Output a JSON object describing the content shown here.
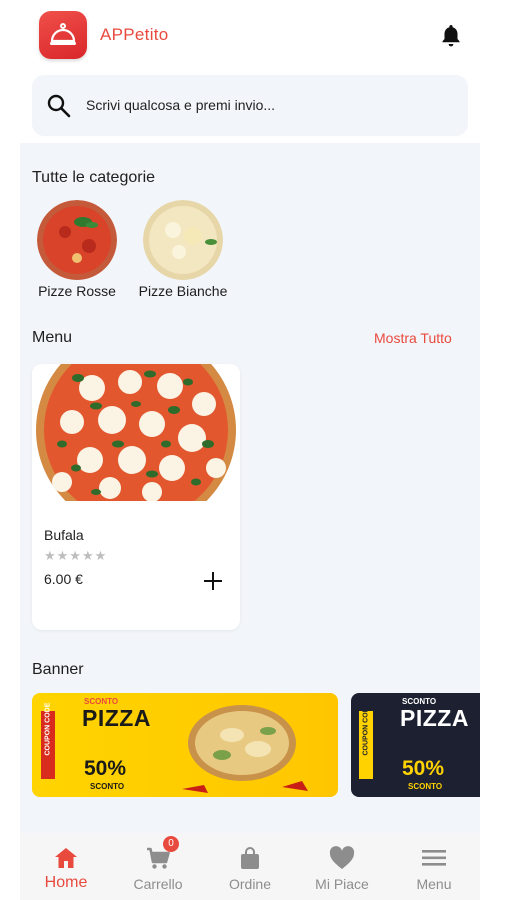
{
  "header": {
    "app_title": "APPetito",
    "logo_icon": "cloche-icon",
    "notification_icon": "bell-icon"
  },
  "search": {
    "placeholder": "Scrivi qualcosa e premi invio..."
  },
  "categories": {
    "title": "Tutte le categorie",
    "items": [
      {
        "label": "Pizze Rosse"
      },
      {
        "label": "Pizze Bianche"
      }
    ]
  },
  "menu": {
    "title": "Menu",
    "show_all": "Mostra Tutto",
    "items": [
      {
        "name": "Bufala",
        "rating": 0,
        "rating_max": 5,
        "price": "6.00 €"
      }
    ]
  },
  "banner": {
    "title": "Banner",
    "items": [
      {
        "tag": "COUPON CODE",
        "discount_label": "SCONTO",
        "headline": "PIZZA",
        "percent": "50%",
        "sub": "SCONTO"
      },
      {
        "tag": "COUPON CODE",
        "discount_label": "SCONTO",
        "headline": "PIZZA",
        "percent": "50%",
        "sub": "SCONTO"
      }
    ]
  },
  "bottom_nav": {
    "items": [
      {
        "label": "Home",
        "icon": "home-icon",
        "active": true
      },
      {
        "label": "Carrello",
        "icon": "cart-icon",
        "badge": "0"
      },
      {
        "label": "Ordine",
        "icon": "bag-icon"
      },
      {
        "label": "Mi Piace",
        "icon": "heart-icon"
      },
      {
        "label": "Menu",
        "icon": "hamburger-icon"
      }
    ]
  },
  "colors": {
    "accent": "#e94a3e",
    "section_bg": "#f2f5f9",
    "banner_yellow": "#ffd200",
    "banner_dark": "#1c2030"
  }
}
